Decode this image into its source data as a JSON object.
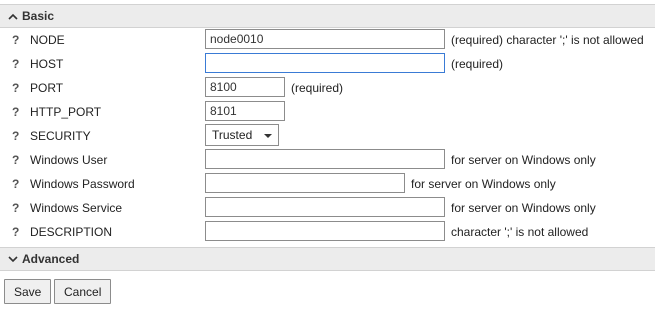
{
  "sections": {
    "basic": {
      "title": "Basic",
      "expanded": true
    },
    "advanced": {
      "title": "Advanced",
      "expanded": false
    }
  },
  "help_glyph": "?",
  "fields": {
    "node": {
      "label": "NODE",
      "value": "node0010",
      "hint": "(required) character ';' is not allowed"
    },
    "host": {
      "label": "HOST",
      "value": "",
      "hint": "(required)"
    },
    "port": {
      "label": "PORT",
      "value": "8100",
      "hint": "(required)"
    },
    "http_port": {
      "label": "HTTP_PORT",
      "value": "8101"
    },
    "security": {
      "label": "SECURITY",
      "selected": "Trusted"
    },
    "windows_user": {
      "label": "Windows User",
      "value": "",
      "hint": "for server on Windows only"
    },
    "windows_password": {
      "label": "Windows Password",
      "value": "",
      "hint": "for server on Windows only"
    },
    "windows_service": {
      "label": "Windows Service",
      "value": "",
      "hint": "for server on Windows only"
    },
    "description": {
      "label": "DESCRIPTION",
      "value": "",
      "hint": "character ';' is not allowed"
    }
  },
  "buttons": {
    "save": "Save",
    "cancel": "Cancel"
  },
  "colors": {
    "header_bg": "#ececec",
    "focus_border": "#3a7bd5"
  }
}
